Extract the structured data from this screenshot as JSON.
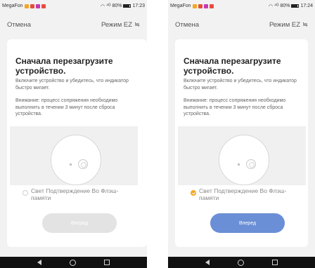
{
  "screens": [
    {
      "status_bar": {
        "carrier": "MegaFon",
        "signal": "⁴ᴳ",
        "battery": "80%",
        "time": "17:23"
      },
      "header": {
        "cancel_label": "Отмена",
        "mode_label": "Режим EZ",
        "mode_icon": "≒"
      },
      "card": {
        "title": "Сначала перезагрузите устройство.",
        "text_1": "Включите устройство и убедитесь, что индикатор быстро мигает.",
        "text_2": "Внимание: процесс сопряжения необходимо выполнить в течении 3 минут после сброса устройства.",
        "confirm_label": "Свет Подтверждение Во Флэш-памяти",
        "confirm_checked": false,
        "next_label": "Вперед",
        "next_enabled": false
      }
    },
    {
      "status_bar": {
        "carrier": "MegaFon",
        "signal": "⁴ᴳ",
        "battery": "80%",
        "time": "17:24"
      },
      "header": {
        "cancel_label": "Отмена",
        "mode_label": "Режим EZ",
        "mode_icon": "≒"
      },
      "card": {
        "title": "Сначала перезагрузите устройство.",
        "text_1": "Включите устройство и убедитесь, что индикатор быстро мигает.",
        "text_2": "Внимание: процесс сопряжения необходимо выполнить в течении 3 минут после сброса устройства.",
        "confirm_label": "Свет Подтверждение Во Флэш-памяти",
        "confirm_checked": true,
        "next_label": "Вперед",
        "next_enabled": true
      }
    }
  ],
  "colors": {
    "accent_orange": "#f5a623",
    "button_enabled": "#6a8fd6",
    "button_disabled": "#e3e3e3",
    "notif_icons": [
      "#f5a623",
      "#e84c3d",
      "#c43ab3",
      "#e84c3d"
    ]
  }
}
